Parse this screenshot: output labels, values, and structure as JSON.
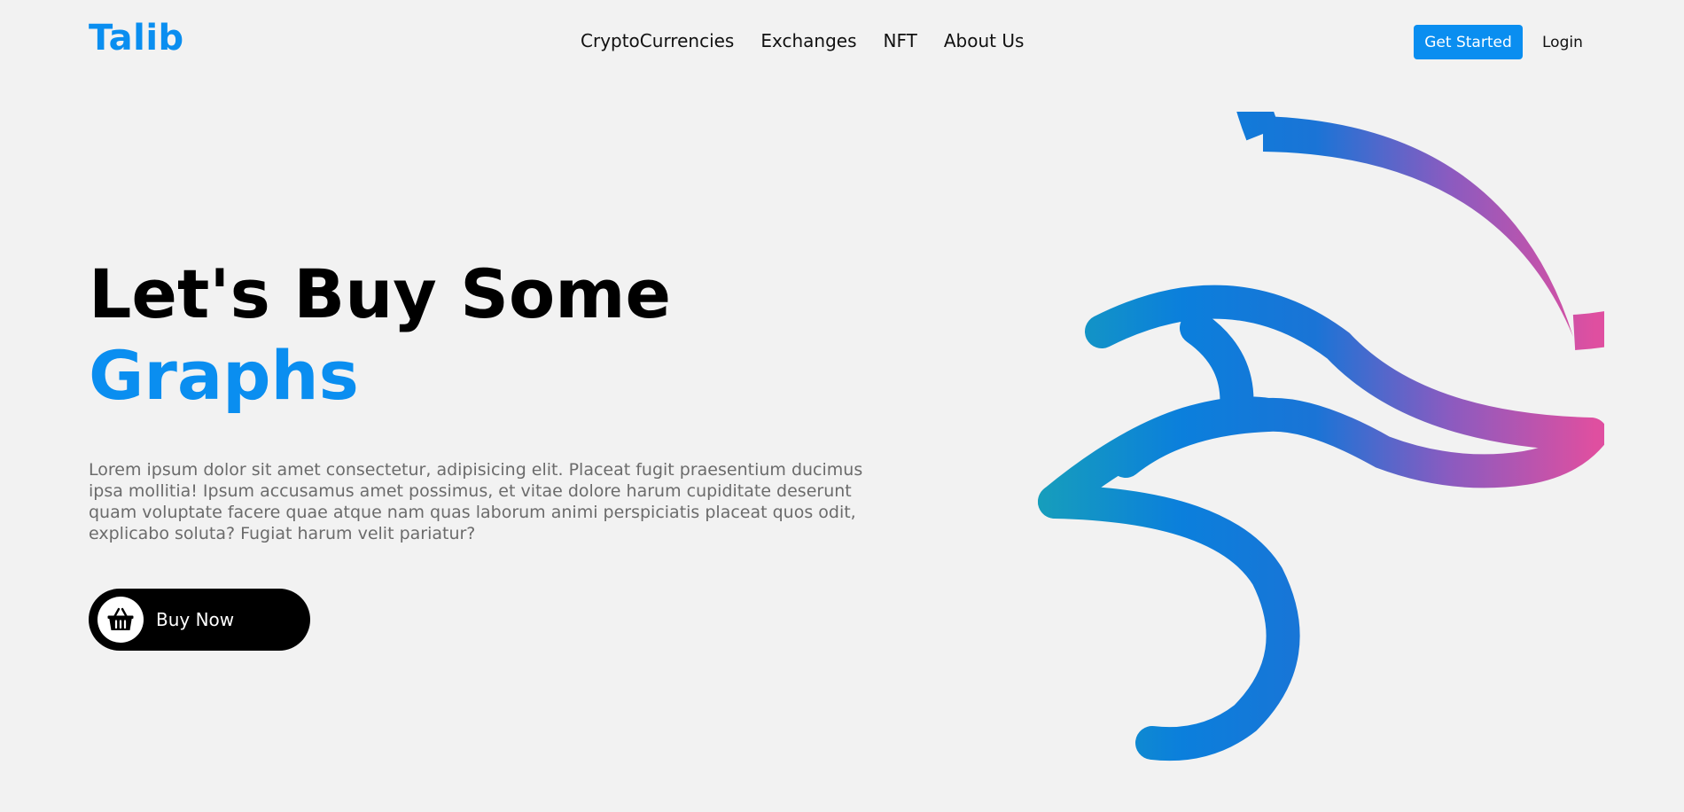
{
  "nav": {
    "logo": "Talib",
    "links": [
      "CryptoCurrencies",
      "Exchanges",
      "NFT",
      "About Us"
    ],
    "cta": "Get Started",
    "login": "Login"
  },
  "hero": {
    "title_line1": "Let's Buy Some",
    "title_line2": "Graphs",
    "description": "Lorem ipsum dolor sit amet consectetur, adipisicing elit. Placeat fugit praesentium ducimus ipsa mollitia! Ipsum accusamus amet possimus, et vitae dolore harum cupiditate deserunt quam voluptate facere quae atque nam quas laborum animi perspiciatis placeat quos odit, explicabo soluta? Fugiat harum velit pariatur?",
    "buy_button": "Buy Now",
    "buy_icon": "basket-icon",
    "art_icon": "gradient-bird-logo-icon"
  },
  "colors": {
    "accent": "#0a8ef0",
    "background": "#f2f2f2",
    "gradient": [
      "#1fb5a3",
      "#0b7fdc",
      "#8a5bc0",
      "#df4fa0"
    ]
  }
}
